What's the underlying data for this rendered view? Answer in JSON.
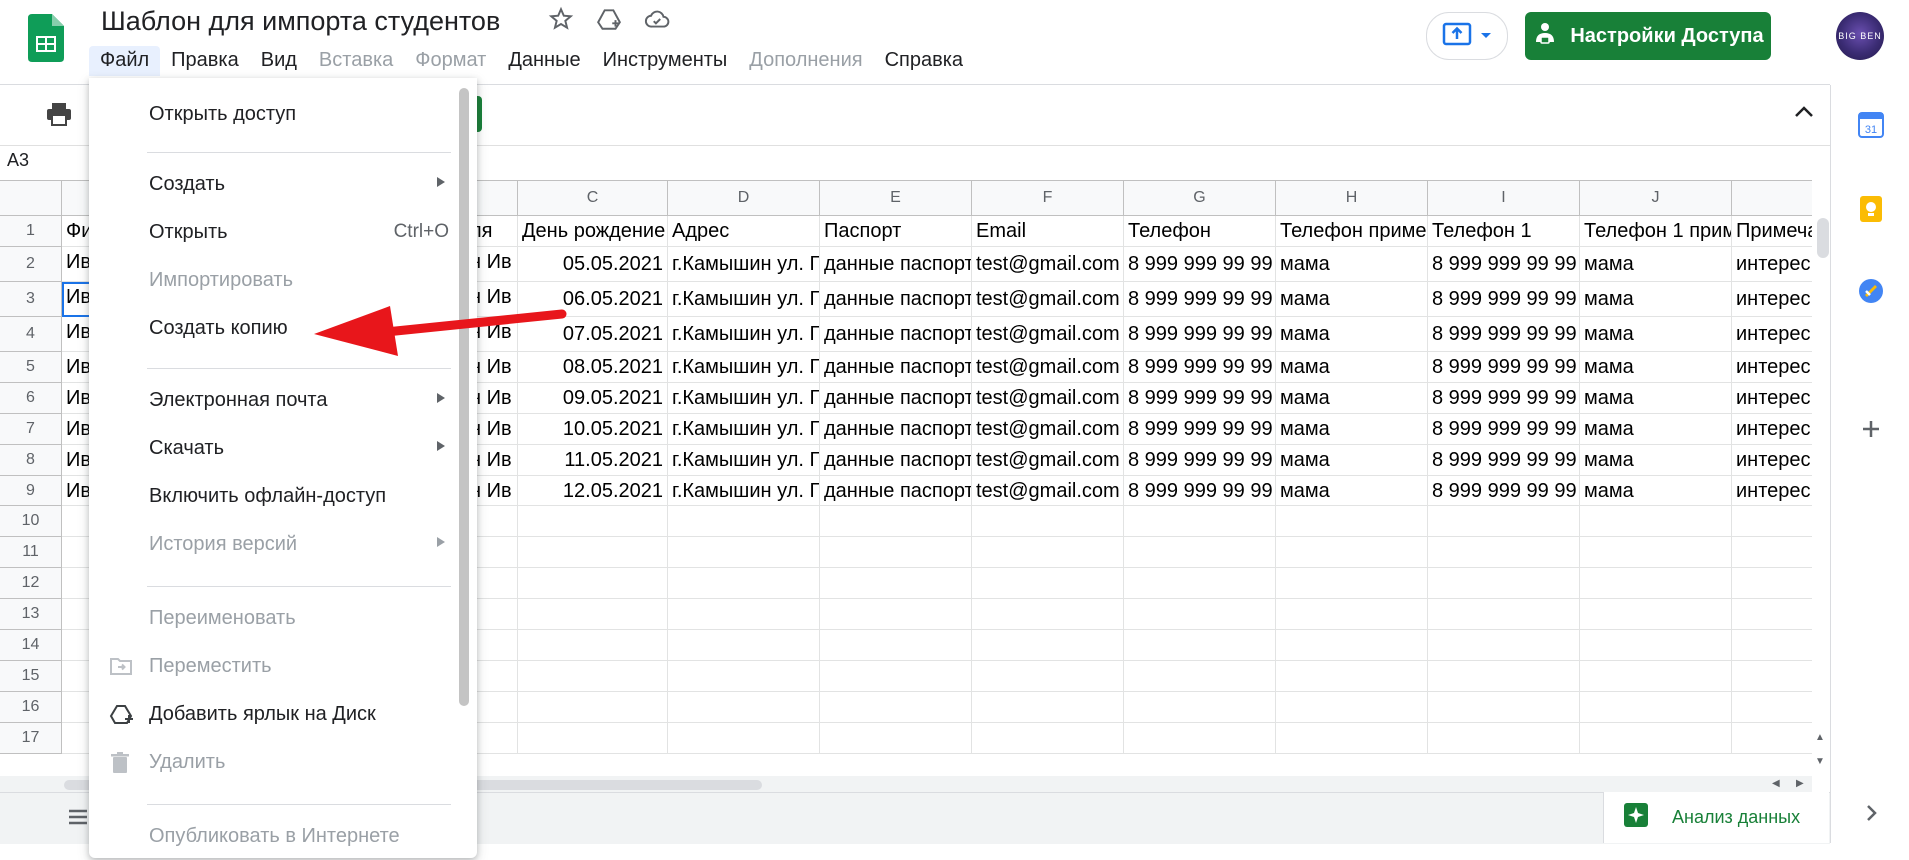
{
  "app": {
    "title": "Шаблон для импорта студентов",
    "avatar_text": "BIG BEN"
  },
  "menubar": [
    {
      "label": "Файл",
      "disabled": false,
      "active": true
    },
    {
      "label": "Правка",
      "disabled": false
    },
    {
      "label": "Вид",
      "disabled": false
    },
    {
      "label": "Вставка",
      "disabled": true
    },
    {
      "label": "Формат",
      "disabled": true
    },
    {
      "label": "Данные",
      "disabled": false
    },
    {
      "label": "Инструменты",
      "disabled": false
    },
    {
      "label": "Дополнения",
      "disabled": true
    },
    {
      "label": "Справка",
      "disabled": false
    }
  ],
  "share_button": {
    "label": "Настройки Доступа"
  },
  "name_box": "A3",
  "grid": {
    "column_headers": [
      "C",
      "D",
      "E",
      "F",
      "G",
      "H",
      "I",
      "J"
    ],
    "row_numbers": [
      "1",
      "2",
      "3",
      "4",
      "5",
      "6",
      "7",
      "8",
      "9",
      "10",
      "11",
      "12",
      "13",
      "14",
      "15",
      "16",
      "17"
    ],
    "col_a_visible": [
      "Фи",
      "Ив",
      "Ив",
      "Ив",
      "Ив",
      "Ив",
      "Ив",
      "Ив",
      "Ив"
    ],
    "col_b_visible": [
      "ля",
      "н Ив",
      "н Ив",
      "н Ив",
      "н Ив",
      "н Ив",
      "н Ив",
      "н Ив",
      "н Ив"
    ],
    "header_row": [
      "День рождение",
      "Адрес",
      "Паспорт",
      "Email",
      "Телефон",
      "Телефон приме",
      "Телефон 1",
      "Телефон 1 прим",
      "Примеча"
    ],
    "rows": [
      [
        "05.05.2021",
        "г.Камышин ул. Г",
        "данные паспорт",
        "test@gmail.com",
        "8 999 999 99 99",
        "мама",
        "8 999 999 99 99",
        "мама",
        "интерес"
      ],
      [
        "06.05.2021",
        "г.Камышин ул. Г",
        "данные паспорт",
        "test@gmail.com",
        "8 999 999 99 99",
        "мама",
        "8 999 999 99 99",
        "мама",
        "интерес"
      ],
      [
        "07.05.2021",
        "г.Камышин ул. Г",
        "данные паспорт",
        "test@gmail.com",
        "8 999 999 99 99",
        "мама",
        "8 999 999 99 99",
        "мама",
        "интерес"
      ],
      [
        "08.05.2021",
        "г.Камышин ул. Г",
        "данные паспорт",
        "test@gmail.com",
        "8 999 999 99 99",
        "мама",
        "8 999 999 99 99",
        "мама",
        "интерес"
      ],
      [
        "09.05.2021",
        "г.Камышин ул. Г",
        "данные паспорт",
        "test@gmail.com",
        "8 999 999 99 99",
        "мама",
        "8 999 999 99 99",
        "мама",
        "интерес"
      ],
      [
        "10.05.2021",
        "г.Камышин ул. Г",
        "данные паспорт",
        "test@gmail.com",
        "8 999 999 99 99",
        "мама",
        "8 999 999 99 99",
        "мама",
        "интерес"
      ],
      [
        "11.05.2021",
        "г.Камышин ул. Г",
        "данные паспорт",
        "test@gmail.com",
        "8 999 999 99 99",
        "мама",
        "8 999 999 99 99",
        "мама",
        "интерес"
      ],
      [
        "12.05.2021",
        "г.Камышин ул. Г",
        "данные паспорт",
        "test@gmail.com",
        "8 999 999 99 99",
        "мама",
        "8 999 999 99 99",
        "мама",
        "интерес"
      ]
    ]
  },
  "file_menu": {
    "items": [
      {
        "label": "Открыть доступ",
        "disabled": false
      },
      {
        "label": "Создать",
        "disabled": false,
        "submenu": true
      },
      {
        "label": "Открыть",
        "disabled": false,
        "shortcut": "Ctrl+O"
      },
      {
        "label": "Импортировать",
        "disabled": true
      },
      {
        "label": "Создать копию",
        "disabled": false
      },
      {
        "label": "Электронная почта",
        "disabled": false,
        "submenu": true
      },
      {
        "label": "Скачать",
        "disabled": false,
        "submenu": true
      },
      {
        "label": "Включить офлайн-доступ",
        "disabled": false
      },
      {
        "label": "История версий",
        "disabled": true,
        "submenu": true
      },
      {
        "label": "Переименовать",
        "disabled": true
      },
      {
        "label": "Переместить",
        "disabled": true,
        "icon": "move-folder-icon"
      },
      {
        "label": "Добавить ярлык на Диск",
        "disabled": false,
        "icon": "drive-shortcut-icon"
      },
      {
        "label": "Удалить",
        "disabled": true,
        "icon": "trash-icon"
      },
      {
        "label": "Опубликовать в Интернете",
        "disabled": true
      }
    ]
  },
  "analyze": {
    "label": "Анализ данных"
  },
  "colors": {
    "accent_green": "#188038",
    "selection_blue": "#1a73e8",
    "annotation_arrow": "#e8161b"
  }
}
